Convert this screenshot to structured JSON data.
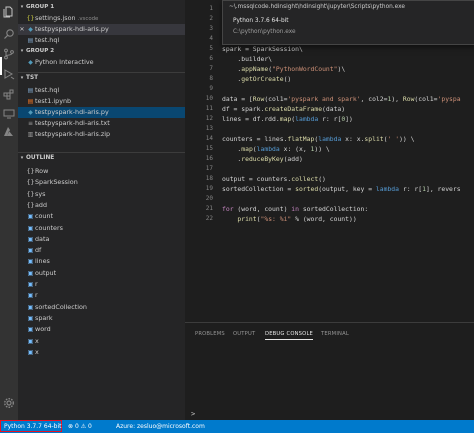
{
  "sidebar": {
    "open_editors": [
      {
        "label": "GROUP 1",
        "type": "group"
      },
      {
        "label": "settings.json",
        "desc": ".vscode",
        "type": "file",
        "icon": "braces-icon"
      },
      {
        "label": "testpyspark-hdi-aris.py",
        "type": "file",
        "icon": "python-icon",
        "selected": true
      },
      {
        "label": "test.hql",
        "type": "file",
        "icon": "doc-icon"
      },
      {
        "label": "GROUP 2",
        "type": "group"
      },
      {
        "label": "Python Interactive",
        "type": "file",
        "icon": "python-icon"
      }
    ],
    "folder_title": "TST",
    "files": [
      "test.hql",
      "test1.ipynb",
      "testpyspark-hdi-aris.py",
      "testpyspark-hdi-aris.txt",
      "testpyspark-hdi-aris.zip"
    ],
    "outline_title": "OUTLINE",
    "outline": [
      {
        "label": "Row",
        "icon": "braces"
      },
      {
        "label": "SparkSession",
        "icon": "braces"
      },
      {
        "label": "sys",
        "icon": "braces"
      },
      {
        "label": "add",
        "icon": "braces"
      },
      {
        "label": "count",
        "icon": "var"
      },
      {
        "label": "counters",
        "icon": "var"
      },
      {
        "label": "data",
        "icon": "var"
      },
      {
        "label": "df",
        "icon": "var"
      },
      {
        "label": "lines",
        "icon": "var"
      },
      {
        "label": "output",
        "icon": "var"
      },
      {
        "label": "r",
        "icon": "var"
      },
      {
        "label": "r",
        "icon": "var"
      },
      {
        "label": "sortedCollection",
        "icon": "var"
      },
      {
        "label": "spark",
        "icon": "var"
      },
      {
        "label": "word",
        "icon": "var"
      },
      {
        "label": "x",
        "icon": "var"
      },
      {
        "label": "x",
        "icon": "var"
      }
    ]
  },
  "popup": {
    "path_hint": "~\\.mssqlcode.hdinsight\\hdinsight\\jupyter\\Scripts\\python.exe",
    "option_title": "Python 3.7.6 64-bit",
    "option_path": "C:\\python\\python.exe"
  },
  "editor": {
    "line_numbers": [
      "1",
      "2",
      "3",
      "4",
      "5",
      "6",
      "7",
      "8",
      "9",
      "10",
      "11",
      "12",
      "13",
      "14",
      "15",
      "16",
      "17",
      "18",
      "19",
      "20",
      "21",
      "22"
    ]
  },
  "panel": {
    "tabs": [
      "PROBLEMS",
      "OUTPUT",
      "DEBUG CONSOLE",
      "TERMINAL"
    ],
    "active_tab": "DEBUG CONSOLE",
    "prompt": ">"
  },
  "status": {
    "interpreter": "Python 3.7.7 64-bit",
    "errors": "0",
    "warnings": "0",
    "account": "Azure: zesluo@microsoft.com"
  },
  "colors": {
    "status_bar": "#007acc",
    "highlight": "#e81123",
    "keyword": "#c586c0",
    "string": "#ce9178"
  }
}
